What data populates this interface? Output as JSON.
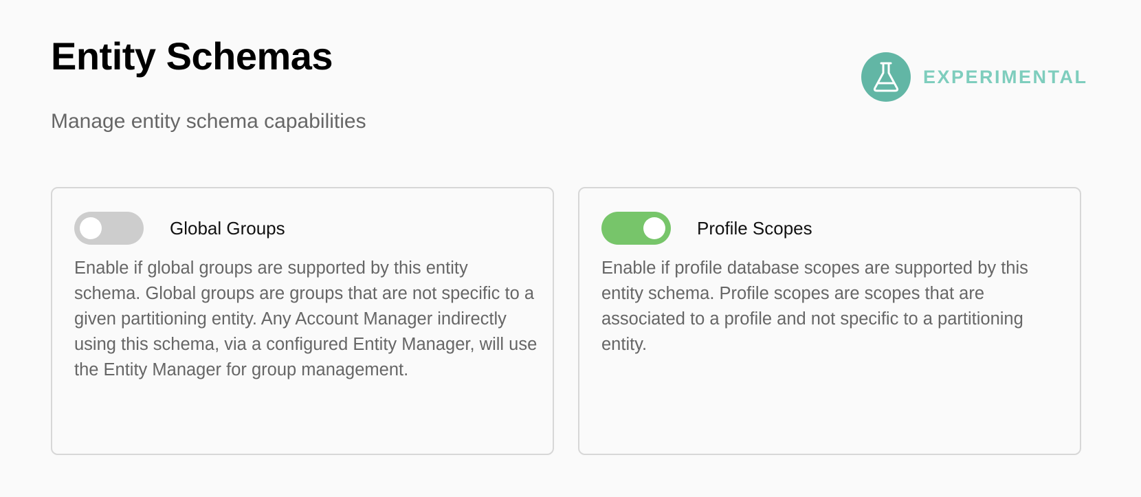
{
  "header": {
    "title": "Entity Schemas",
    "subtitle": "Manage entity schema capabilities"
  },
  "badge": {
    "label": "EXPERIMENTAL",
    "icon": "flask-icon",
    "color": "#62b6a5",
    "text_color": "#7ecdbd"
  },
  "cards": [
    {
      "title": "Global Groups",
      "enabled": false,
      "description": "Enable if global groups are supported by this entity schema. Global groups are groups that are not specific to a given partitioning entity. Any Account Manager indirectly using this schema, via a configured Entity Manager, will use the Entity Manager for group management."
    },
    {
      "title": "Profile Scopes",
      "enabled": true,
      "description": "Enable if profile database scopes are supported by this entity schema. Profile scopes are scopes that are associated to a profile and not specific to a partitioning entity."
    }
  ],
  "colors": {
    "toggle_on": "#77c56a",
    "toggle_off": "#cdcdcd"
  }
}
